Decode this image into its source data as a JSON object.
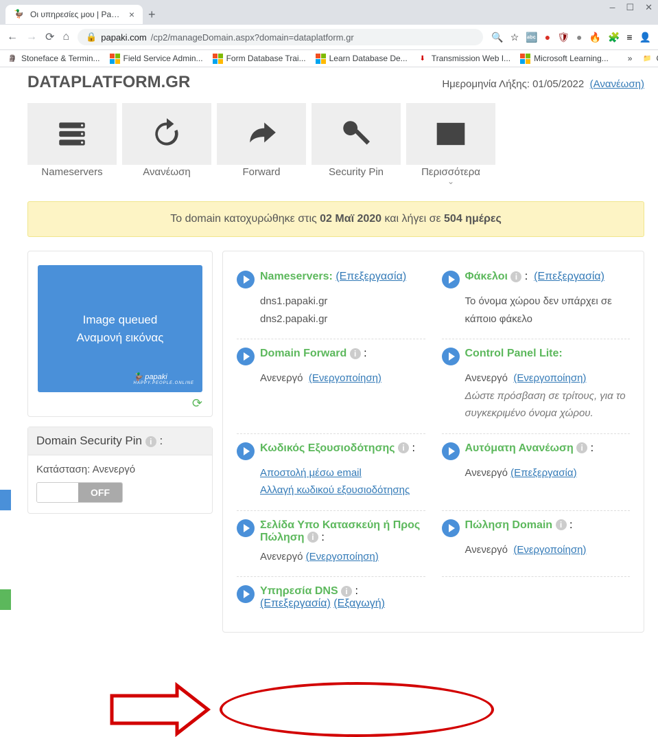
{
  "browser": {
    "tab_title": "Οι υπηρεσίες μου | Papaki Contr...",
    "url_prefix": "papaki.com",
    "url_path": "/cp2/manageDomain.aspx?domain=dataplatform.gr",
    "bookmarks": [
      "Stoneface & Termin...",
      "Field Service Admin...",
      "Form Database Trai...",
      "Learn Database De...",
      "Transmission Web I...",
      "Microsoft Learning..."
    ],
    "other_bookmarks": "Other bo"
  },
  "domain": {
    "name": "DATAPLATFORM.GR",
    "expiry_label": "Ημερομηνία Λήξης: 01/05/2022",
    "renew_link": "(Ανανέωση)"
  },
  "actions": [
    "Nameservers",
    "Ανανέωση",
    "Forward",
    "Security Pin",
    "Περισσότερα"
  ],
  "notice": {
    "pre": "Το domain κατοχυρώθηκε στις ",
    "date": "02 Μαϊ 2020",
    "mid": " και λήγει σε ",
    "days": "504 ημέρες"
  },
  "preview": {
    "line1": "Image queued",
    "line2": "Αναμονή εικόνας",
    "logo": "papaki"
  },
  "pin": {
    "header": "Domain Security Pin",
    "status_label": "Κατάσταση: Ανενεργό",
    "off": "OFF"
  },
  "settings": {
    "ns": {
      "title": "Nameservers:",
      "edit": "(Επεξεργασία)",
      "v1": "dns1.papaki.gr",
      "v2": "dns2.papaki.gr"
    },
    "folders": {
      "title": "Φάκελοι",
      "edit": "(Επεξεργασία)",
      "body": "Το όνομα χώρου δεν υπάρχει σε κάποιο φάκελο"
    },
    "forward": {
      "title": "Domain Forward",
      "status": "Ανενεργό",
      "link": "(Ενεργοποίηση)"
    },
    "cpl": {
      "title": "Control Panel Lite:",
      "status": "Ανενεργό",
      "link": "(Ενεργοποίηση)",
      "desc": "Δώστε πρόσβαση σε τρίτους, για το συγκεκριμένο όνομα χώρου."
    },
    "auth": {
      "title": "Κωδικός Εξουσιοδότησης",
      "l1": "Αποστολή μέσω email",
      "l2": "Αλλαγή κωδικού εξουσιοδότησης"
    },
    "autorenew": {
      "title": "Αυτόματη Ανανέωση",
      "status": "Ανενεργό",
      "link": "(Επεξεργασία)"
    },
    "construction": {
      "title": "Σελίδα Υπο Κατασκεύη ή Προς Πώληση",
      "status": "Ανενεργό",
      "link": "(Ενεργοποίηση)"
    },
    "sell": {
      "title": "Πώληση Domain",
      "status": "Ανενεργό",
      "link": "(Ενεργοποίηση)"
    },
    "dns": {
      "title": "Υπηρεσία DNS",
      "l1": "(Επεξεργασία)",
      "l2": "(Εξαγωγή)"
    }
  }
}
